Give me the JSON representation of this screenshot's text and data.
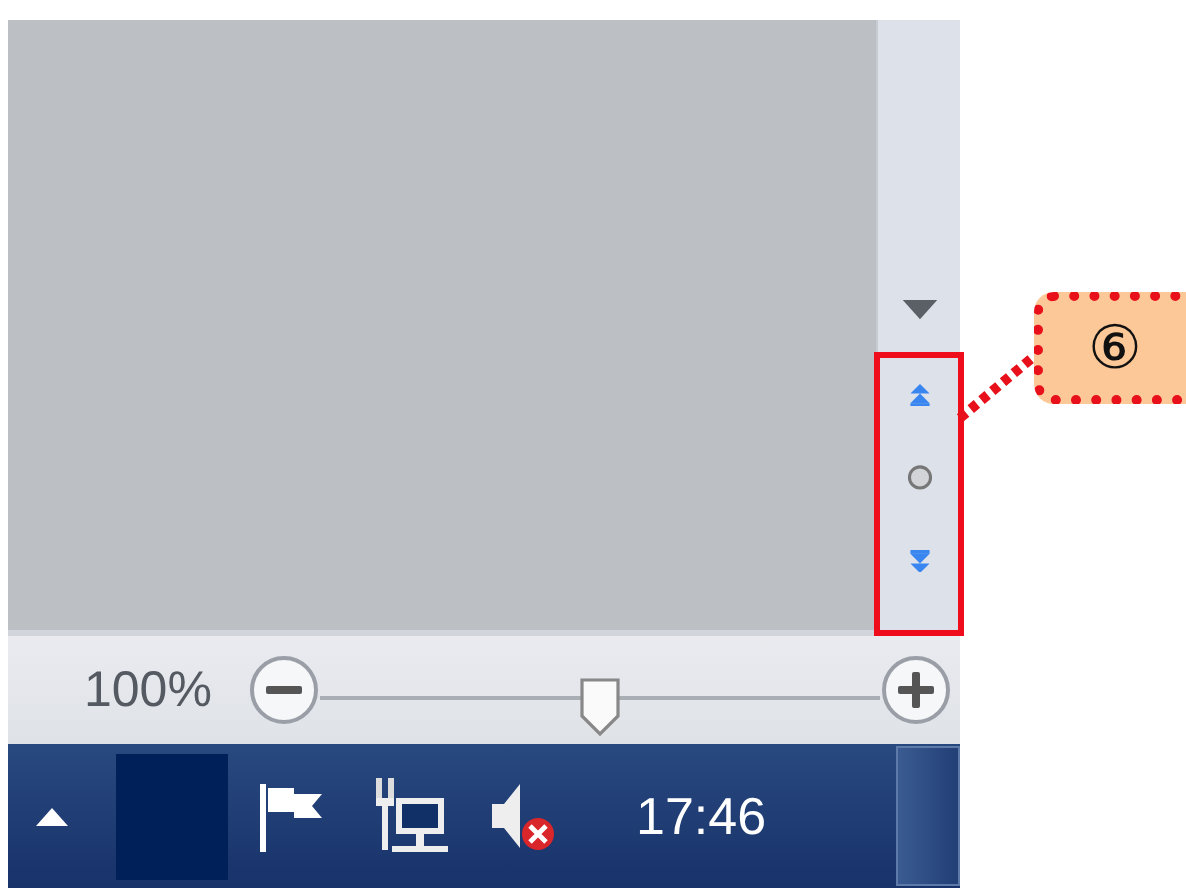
{
  "status_bar": {
    "zoom_label": "100%",
    "zoom_slider": {
      "level": 0.5
    }
  },
  "taskbar": {
    "volume": {
      "muted": true
    },
    "clock": "17:46"
  },
  "annotation": {
    "label": "⑥"
  }
}
